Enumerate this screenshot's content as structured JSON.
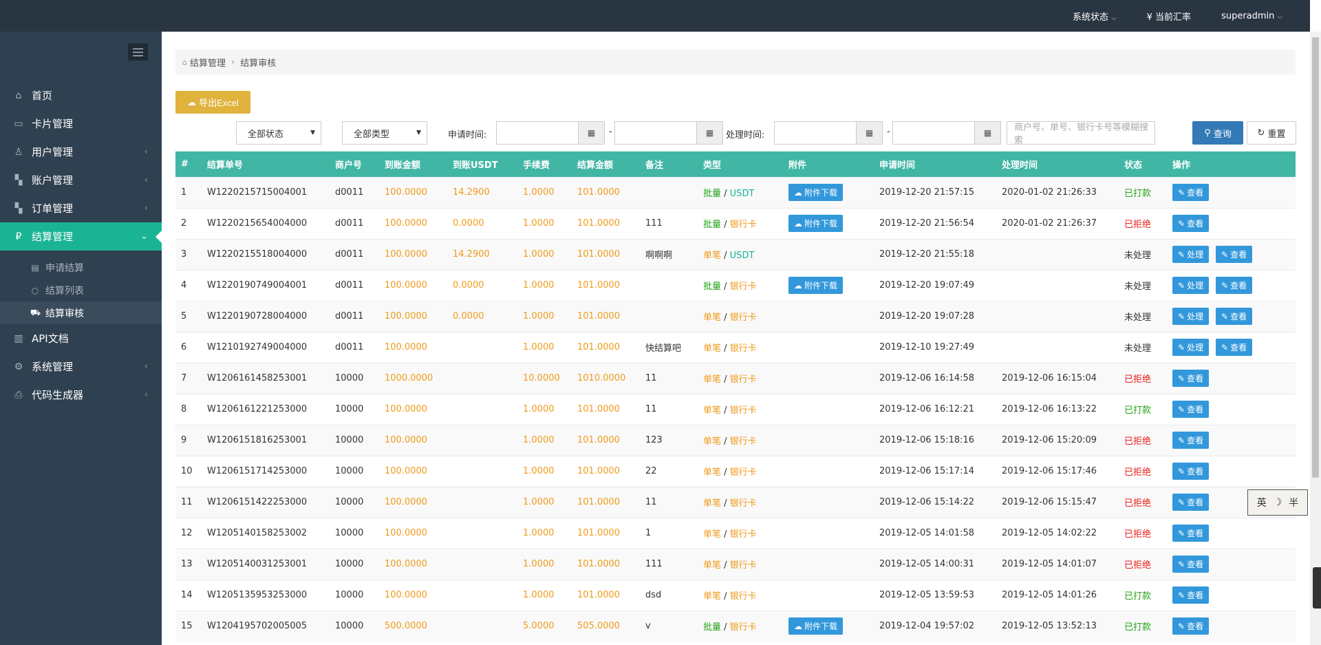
{
  "topbar": {
    "system_status": "系统状态",
    "exchange_rate": "¥ 当前汇率",
    "user": "superadmin"
  },
  "sidebar": {
    "items": [
      {
        "label": "首页",
        "icon": "home-icon"
      },
      {
        "label": "卡片管理",
        "icon": "card-icon"
      },
      {
        "label": "用户管理",
        "icon": "user-icon"
      },
      {
        "label": "账户管理",
        "icon": "account-icon"
      },
      {
        "label": "订单管理",
        "icon": "order-icon"
      },
      {
        "label": "结算管理",
        "icon": "settlement-icon"
      },
      {
        "label": "API文档",
        "icon": "doc-icon"
      },
      {
        "label": "系统管理",
        "icon": "gear-icon"
      },
      {
        "label": "代码生成器",
        "icon": "printer-icon"
      }
    ],
    "sub_items": [
      {
        "label": "申请结算"
      },
      {
        "label": "结算列表"
      },
      {
        "label": "结算审核"
      }
    ]
  },
  "breadcrumb": {
    "parent": "结算管理",
    "current": "结算审核"
  },
  "toolbar": {
    "export_label": "导出Excel",
    "status_select": "全部状态",
    "type_select": "全部类型",
    "apply_time_label": "申请时间:",
    "process_time_label": "处理时间:",
    "dash": "-",
    "search_placeholder": "商户号、单号、银行卡号等模糊搜索",
    "query_label": "查询",
    "reset_label": "重置"
  },
  "table": {
    "headers": [
      "#",
      "结算单号",
      "商户号",
      "到账金额",
      "到账USDT",
      "手续费",
      "结算金额",
      "备注",
      "类型",
      "附件",
      "申请时间",
      "处理时间",
      "状态",
      "操作"
    ],
    "type_sep": " / ",
    "attach_label": "附件下载",
    "process_label": "处理",
    "view_label": "查看",
    "rows": [
      {
        "n": "1",
        "id": "W1220215715004001",
        "merchant": "d0011",
        "amount": "100.0000",
        "usdt": "14.2900",
        "fee": "1.0000",
        "total": "101.0000",
        "note": "",
        "t1": "批量",
        "t2": "USDT",
        "attach": true,
        "apply": "2019-12-20 21:57:15",
        "process": "2020-01-02 21:26:33",
        "status": "已打款",
        "st": "paid",
        "proc": false
      },
      {
        "n": "2",
        "id": "W1220215654004000",
        "merchant": "d0011",
        "amount": "100.0000",
        "usdt": "0.0000",
        "fee": "1.0000",
        "total": "101.0000",
        "note": "111",
        "t1": "批量",
        "t2": "银行卡",
        "attach": true,
        "apply": "2019-12-20 21:56:54",
        "process": "2020-01-02 21:26:37",
        "status": "已拒绝",
        "st": "rej",
        "proc": false
      },
      {
        "n": "3",
        "id": "W1220215518004000",
        "merchant": "d0011",
        "amount": "100.0000",
        "usdt": "14.2900",
        "fee": "1.0000",
        "total": "101.0000",
        "note": "啊啊啊",
        "t1": "单笔",
        "t2": "USDT",
        "attach": false,
        "apply": "2019-12-20 21:55:18",
        "process": "",
        "status": "未处理",
        "st": "pend",
        "proc": true
      },
      {
        "n": "4",
        "id": "W1220190749004001",
        "merchant": "d0011",
        "amount": "100.0000",
        "usdt": "0.0000",
        "fee": "1.0000",
        "total": "101.0000",
        "note": "",
        "t1": "批量",
        "t2": "银行卡",
        "attach": true,
        "apply": "2019-12-20 19:07:49",
        "process": "",
        "status": "未处理",
        "st": "pend",
        "proc": true
      },
      {
        "n": "5",
        "id": "W1220190728004000",
        "merchant": "d0011",
        "amount": "100.0000",
        "usdt": "0.0000",
        "fee": "1.0000",
        "total": "101.0000",
        "note": "",
        "t1": "单笔",
        "t2": "银行卡",
        "attach": false,
        "apply": "2019-12-20 19:07:28",
        "process": "",
        "status": "未处理",
        "st": "pend",
        "proc": true
      },
      {
        "n": "6",
        "id": "W1210192749004000",
        "merchant": "d0011",
        "amount": "100.0000",
        "usdt": "",
        "fee": "1.0000",
        "total": "101.0000",
        "note": "快结算吧",
        "t1": "单笔",
        "t2": "银行卡",
        "attach": false,
        "apply": "2019-12-10 19:27:49",
        "process": "",
        "status": "未处理",
        "st": "pend",
        "proc": true
      },
      {
        "n": "7",
        "id": "W1206161458253001",
        "merchant": "10000",
        "amount": "1000.0000",
        "usdt": "",
        "fee": "10.0000",
        "total": "1010.0000",
        "note": "11",
        "t1": "单笔",
        "t2": "银行卡",
        "attach": false,
        "apply": "2019-12-06 16:14:58",
        "process": "2019-12-06 16:15:04",
        "status": "已拒绝",
        "st": "rej",
        "proc": false
      },
      {
        "n": "8",
        "id": "W1206161221253000",
        "merchant": "10000",
        "amount": "100.0000",
        "usdt": "",
        "fee": "1.0000",
        "total": "101.0000",
        "note": "11",
        "t1": "单笔",
        "t2": "银行卡",
        "attach": false,
        "apply": "2019-12-06 16:12:21",
        "process": "2019-12-06 16:13:22",
        "status": "已打款",
        "st": "paid",
        "proc": false
      },
      {
        "n": "9",
        "id": "W1206151816253001",
        "merchant": "10000",
        "amount": "100.0000",
        "usdt": "",
        "fee": "1.0000",
        "total": "101.0000",
        "note": "123",
        "t1": "单笔",
        "t2": "银行卡",
        "attach": false,
        "apply": "2019-12-06 15:18:16",
        "process": "2019-12-06 15:20:09",
        "status": "已拒绝",
        "st": "rej",
        "proc": false
      },
      {
        "n": "10",
        "id": "W1206151714253000",
        "merchant": "10000",
        "amount": "100.0000",
        "usdt": "",
        "fee": "1.0000",
        "total": "101.0000",
        "note": "22",
        "t1": "单笔",
        "t2": "银行卡",
        "attach": false,
        "apply": "2019-12-06 15:17:14",
        "process": "2019-12-06 15:17:46",
        "status": "已拒绝",
        "st": "rej",
        "proc": false
      },
      {
        "n": "11",
        "id": "W1206151422253000",
        "merchant": "10000",
        "amount": "100.0000",
        "usdt": "",
        "fee": "1.0000",
        "total": "101.0000",
        "note": "11",
        "t1": "单笔",
        "t2": "银行卡",
        "attach": false,
        "apply": "2019-12-06 15:14:22",
        "process": "2019-12-06 15:15:47",
        "status": "已拒绝",
        "st": "rej",
        "proc": false
      },
      {
        "n": "12",
        "id": "W1205140158253002",
        "merchant": "10000",
        "amount": "100.0000",
        "usdt": "",
        "fee": "1.0000",
        "total": "101.0000",
        "note": "1",
        "t1": "单笔",
        "t2": "银行卡",
        "attach": false,
        "apply": "2019-12-05 14:01:58",
        "process": "2019-12-05 14:02:22",
        "status": "已拒绝",
        "st": "rej",
        "proc": false
      },
      {
        "n": "13",
        "id": "W1205140031253001",
        "merchant": "10000",
        "amount": "100.0000",
        "usdt": "",
        "fee": "1.0000",
        "total": "101.0000",
        "note": "111",
        "t1": "单笔",
        "t2": "银行卡",
        "attach": false,
        "apply": "2019-12-05 14:00:31",
        "process": "2019-12-05 14:01:07",
        "status": "已拒绝",
        "st": "rej",
        "proc": false
      },
      {
        "n": "14",
        "id": "W1205135953253000",
        "merchant": "10000",
        "amount": "100.0000",
        "usdt": "",
        "fee": "1.0000",
        "total": "101.0000",
        "note": "dsd",
        "t1": "单笔",
        "t2": "银行卡",
        "attach": false,
        "apply": "2019-12-05 13:59:53",
        "process": "2019-12-05 14:01:26",
        "status": "已打款",
        "st": "paid",
        "proc": false
      },
      {
        "n": "15",
        "id": "W1204195702005005",
        "merchant": "10000",
        "amount": "500.0000",
        "usdt": "",
        "fee": "5.0000",
        "total": "505.0000",
        "note": "v",
        "t1": "批量",
        "t2": "银行卡",
        "attach": true,
        "apply": "2019-12-04 19:57:02",
        "process": "2019-12-05 13:52:13",
        "status": "已打款",
        "st": "paid",
        "proc": false
      }
    ]
  },
  "ime": {
    "lang": "英",
    "moon": "☽",
    "width": "半"
  },
  "colors": {
    "topbar": "#2a3542",
    "sidebar": "#2f4050",
    "active": "#1ab394",
    "table_header": "#41b6a5",
    "export": "#e0b33c",
    "primary": "#337ab7",
    "button": "#3298db",
    "amount": "#f09a1a",
    "paid": "#24a315",
    "rejected": "#e8201b"
  }
}
